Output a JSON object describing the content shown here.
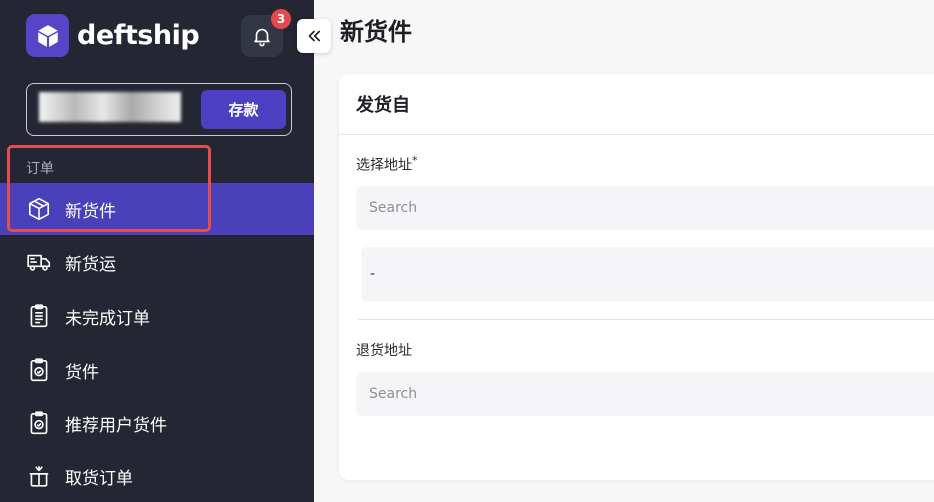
{
  "app": {
    "brand": "deftship",
    "notification_count": "3"
  },
  "balance": {
    "deposit_label": "存款"
  },
  "sidebar": {
    "section_label": "订单",
    "items": [
      {
        "label": "新货件",
        "icon": "package-icon",
        "active": true
      },
      {
        "label": "新货运",
        "icon": "truck-icon"
      },
      {
        "label": "未完成订单",
        "icon": "clipboard-list-icon"
      },
      {
        "label": "货件",
        "icon": "clipboard-check-icon"
      },
      {
        "label": "推荐用户货件",
        "icon": "clipboard-check-icon"
      },
      {
        "label": "取货订单",
        "icon": "pickup-box-icon"
      }
    ]
  },
  "main": {
    "page_title": "新货件",
    "card": {
      "title": "发货自",
      "select_address_label": "选择地址",
      "required_mark": "*",
      "select_address_placeholder": "Search",
      "address_value": "-",
      "return_address_label": "退货地址",
      "return_address_placeholder": "Search"
    }
  },
  "colors": {
    "sidebar_bg": "#242633",
    "accent": "#4a40ba",
    "highlight_border": "#e04e4e",
    "badge": "#e5484d"
  }
}
